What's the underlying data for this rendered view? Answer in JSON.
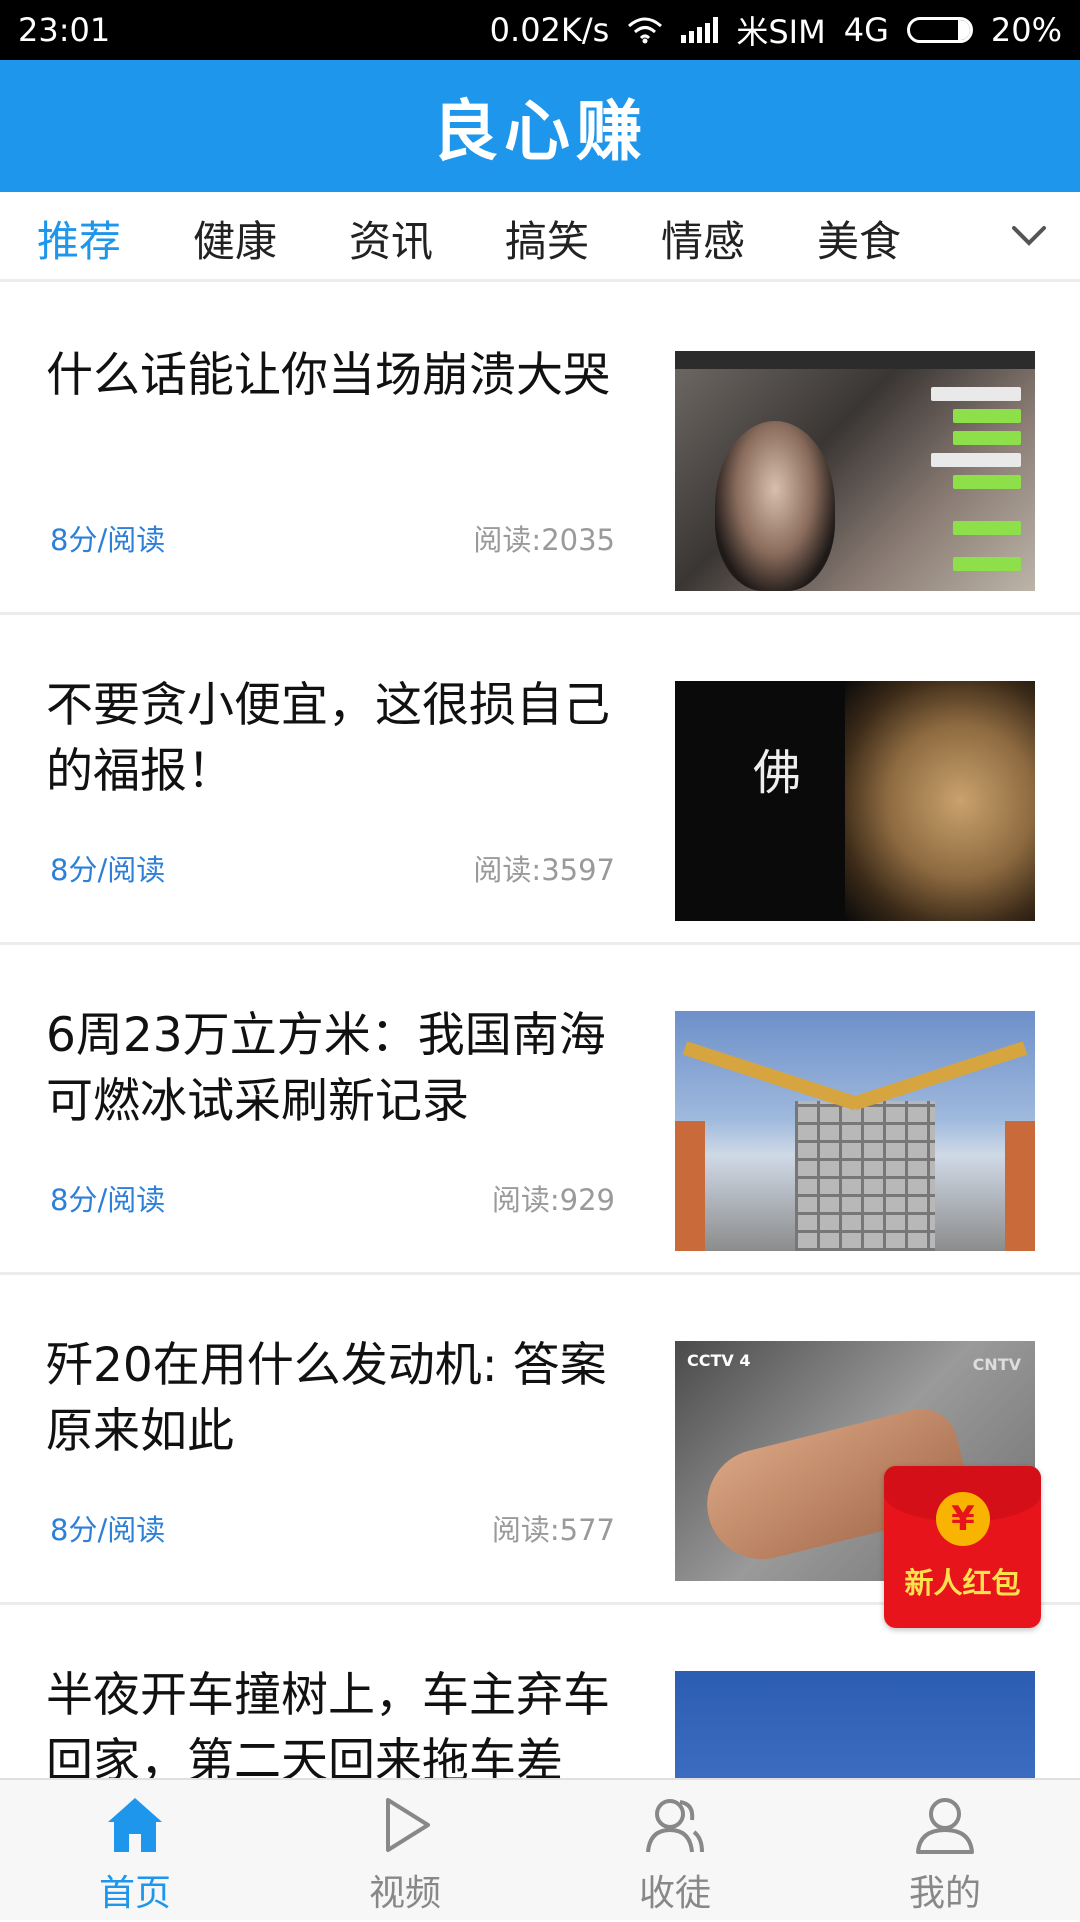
{
  "status_bar": {
    "time": "23:01",
    "net_speed": "0.02K/s",
    "carrier": "米SIM",
    "network": "4G",
    "battery": "20%",
    "battery_level": 0.2
  },
  "header": {
    "title": "良心赚"
  },
  "tabs": [
    {
      "label": "推荐",
      "active": true
    },
    {
      "label": "健康"
    },
    {
      "label": "资讯"
    },
    {
      "label": "搞笑"
    },
    {
      "label": "情感"
    },
    {
      "label": "美食"
    }
  ],
  "feed": [
    {
      "title": "什么话能让你当场崩溃大哭",
      "read_time": "8分/阅读",
      "read_count": "阅读:2035"
    },
    {
      "title": "不要贪小便宜，这很损自己的福报！",
      "read_time": "8分/阅读",
      "read_count": "阅读:3597"
    },
    {
      "title": "6周23万立方米：我国南海可燃冰试采刷新记录",
      "read_time": "8分/阅读",
      "read_count": "阅读:929"
    },
    {
      "title": "歼20在用什么发动机: 答案原来如此",
      "read_time": "8分/阅读",
      "read_count": "阅读:577"
    },
    {
      "title": "半夜开车撞树上，车主弃车回家，第二天回来拖车差",
      "read_time": "",
      "read_count": ""
    }
  ],
  "thumb_text": {
    "t2_glyph": "佛",
    "t4_logo_left": "CCTV 4",
    "t4_logo_right": "CNTV"
  },
  "red_packet": {
    "coin": "¥",
    "label": "新人红包"
  },
  "bottom_nav": [
    {
      "label": "首页",
      "icon": "home-icon",
      "active": true
    },
    {
      "label": "视频",
      "icon": "play-icon"
    },
    {
      "label": "收徒",
      "icon": "people-icon"
    },
    {
      "label": "我的",
      "icon": "user-icon"
    }
  ],
  "colors": {
    "accent": "#1E96EC",
    "red_packet": "#E8141C",
    "read_time": "#2E7FD7"
  }
}
